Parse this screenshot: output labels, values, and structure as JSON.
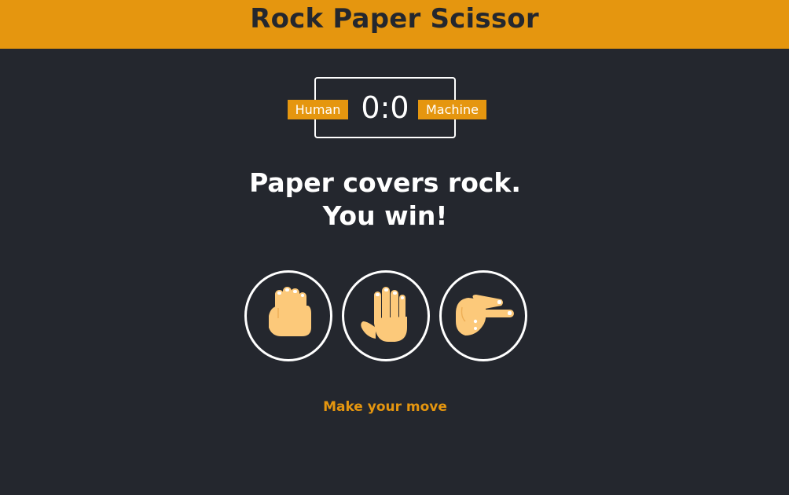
{
  "header": {
    "title": "Rock Paper Scissor"
  },
  "scoreboard": {
    "user_label": "Human",
    "computer_label": "Machine",
    "user_score": "0",
    "separator": ":",
    "computer_score": "0"
  },
  "result": {
    "line1": "Paper covers rock.",
    "line2": "You win!"
  },
  "choices": [
    {
      "id": "rock",
      "icon": "rock-hand-icon"
    },
    {
      "id": "paper",
      "icon": "paper-hand-icon"
    },
    {
      "id": "scissors",
      "icon": "scissors-hand-icon"
    }
  ],
  "action_message": "Make your move",
  "colors": {
    "accent": "#e5960f",
    "background": "#24272e",
    "text": "#ffffff",
    "skin": "#fcc97a"
  }
}
